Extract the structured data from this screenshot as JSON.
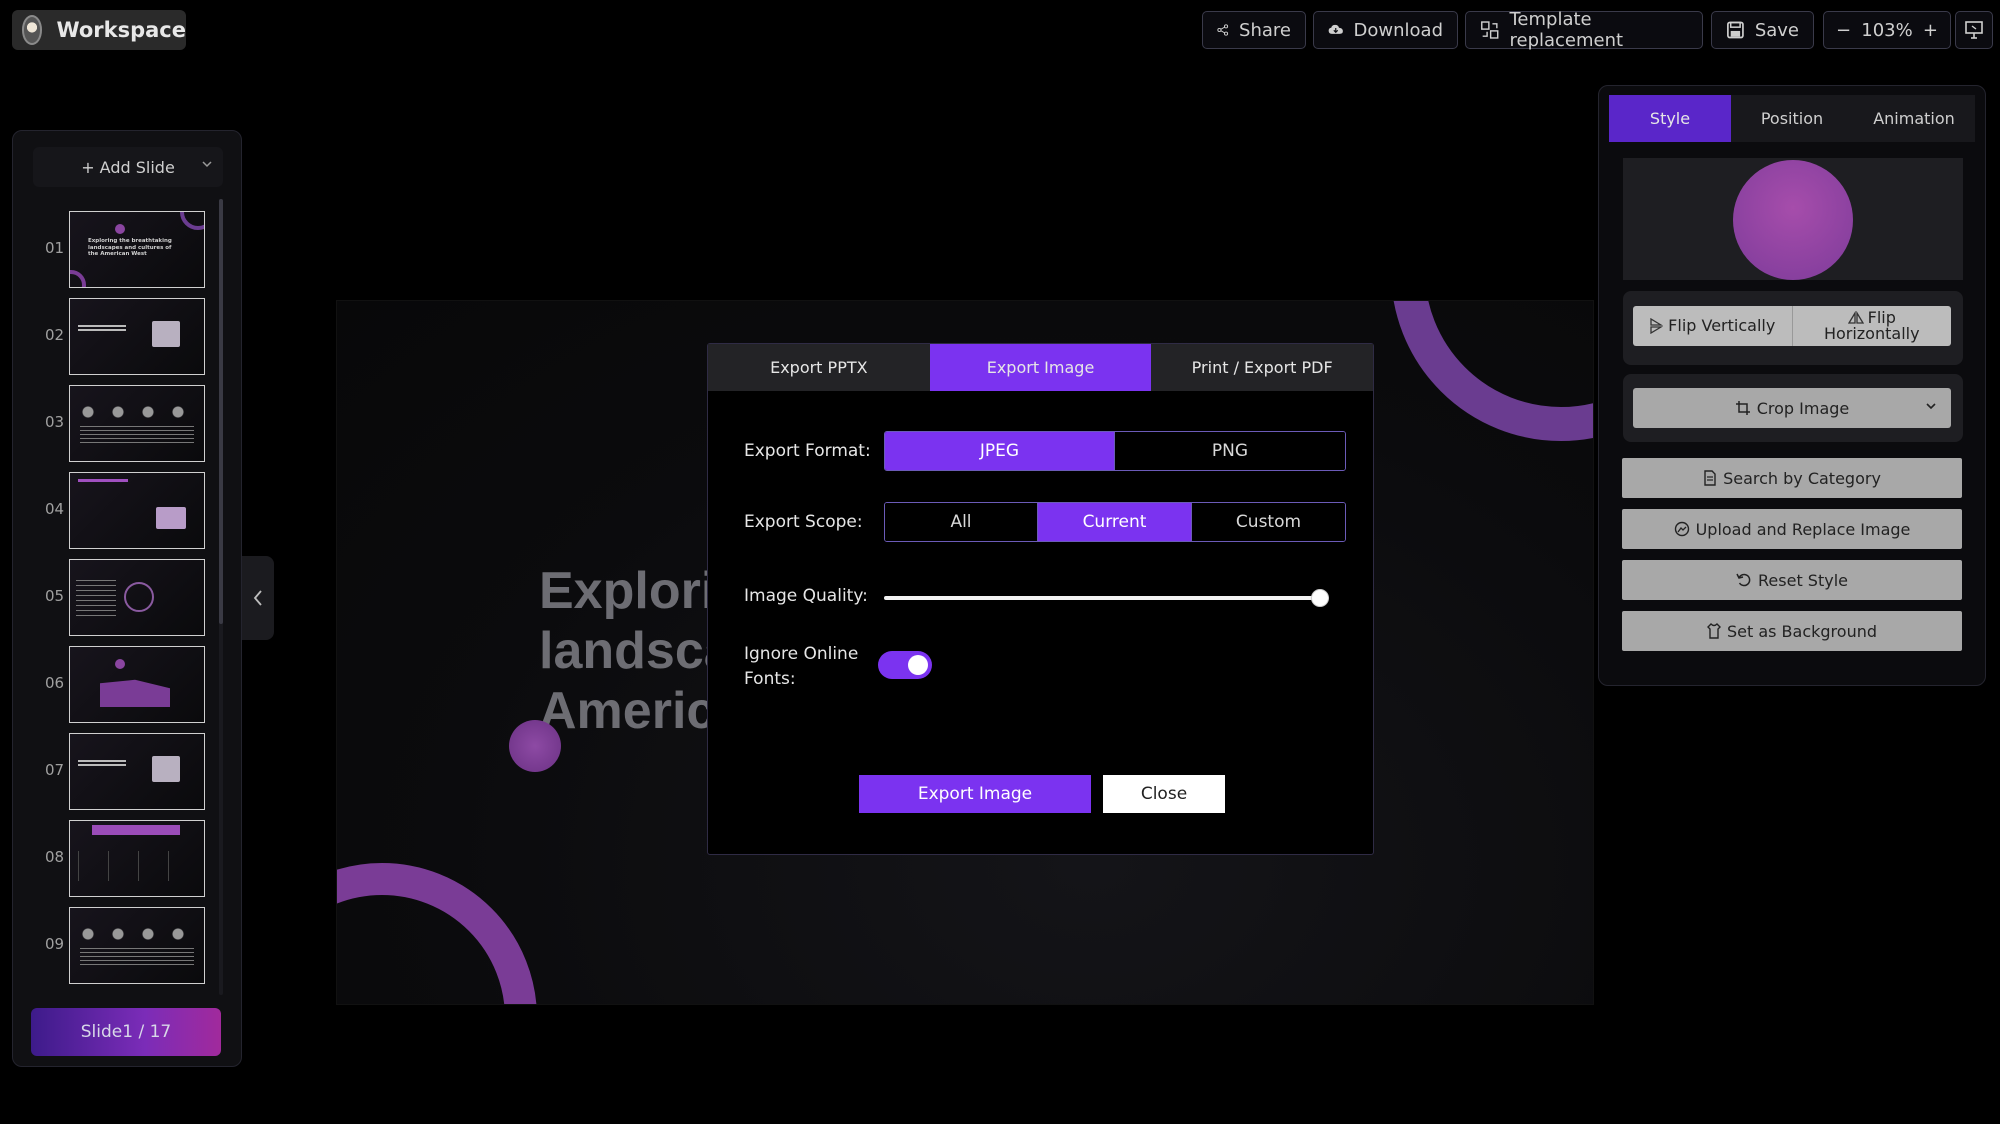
{
  "app": {
    "title": "Workspace",
    "logo_icon": "gorilla-logo-icon"
  },
  "toolbar": {
    "share_label": "Share",
    "download_label": "Download",
    "template_label": "Template replacement",
    "save_label": "Save",
    "zoom_minus": "−",
    "zoom_value": "103%",
    "zoom_plus": "+"
  },
  "sidebar": {
    "add_slide_label": "+ Add Slide",
    "slides": [
      {
        "num": "01",
        "caption": "Exploring the breathtaking landscapes and cultures of the American West"
      },
      {
        "num": "02",
        "caption": ""
      },
      {
        "num": "03",
        "caption": ""
      },
      {
        "num": "04",
        "caption": ""
      },
      {
        "num": "05",
        "caption": ""
      },
      {
        "num": "06",
        "caption": ""
      },
      {
        "num": "07",
        "caption": ""
      },
      {
        "num": "08",
        "caption": ""
      },
      {
        "num": "09",
        "caption": ""
      }
    ],
    "slide_counter": "Slide1 / 17"
  },
  "canvas": {
    "title_lines": [
      "Explori",
      "landsca",
      "Americ"
    ]
  },
  "modal": {
    "tabs": [
      {
        "label": "Export PPTX",
        "active": false
      },
      {
        "label": "Export Image",
        "active": true
      },
      {
        "label": "Print / Export PDF",
        "active": false
      }
    ],
    "format_label": "Export Format:",
    "format_options": [
      {
        "label": "JPEG",
        "selected": true
      },
      {
        "label": "PNG",
        "selected": false
      }
    ],
    "scope_label": "Export Scope:",
    "scope_options": [
      {
        "label": "All",
        "selected": false
      },
      {
        "label": "Current",
        "selected": true
      },
      {
        "label": "Custom",
        "selected": false
      }
    ],
    "quality_label": "Image Quality:",
    "quality_value": 1.0,
    "fonts_label_line1": "Ignore Online",
    "fonts_label_line2": "Fonts:",
    "ignore_fonts_on": true,
    "export_button": "Export Image",
    "close_button": "Close"
  },
  "rightpanel": {
    "tabs": [
      {
        "label": "Style",
        "active": true
      },
      {
        "label": "Position",
        "active": false
      },
      {
        "label": "Animation",
        "active": false
      }
    ],
    "flip_vertical": "Flip Vertically",
    "flip_horizontal_line1": "Flip",
    "flip_horizontal_line2": "Horizontally",
    "crop_image": "Crop Image",
    "search_category": "Search by Category",
    "upload_replace": "Upload and Replace Image",
    "reset_style": "Reset Style",
    "set_background": "Set as Background"
  },
  "colors": {
    "accent": "#7b33f0",
    "tab_active_right": "#5a26c9",
    "background": "#000000"
  }
}
